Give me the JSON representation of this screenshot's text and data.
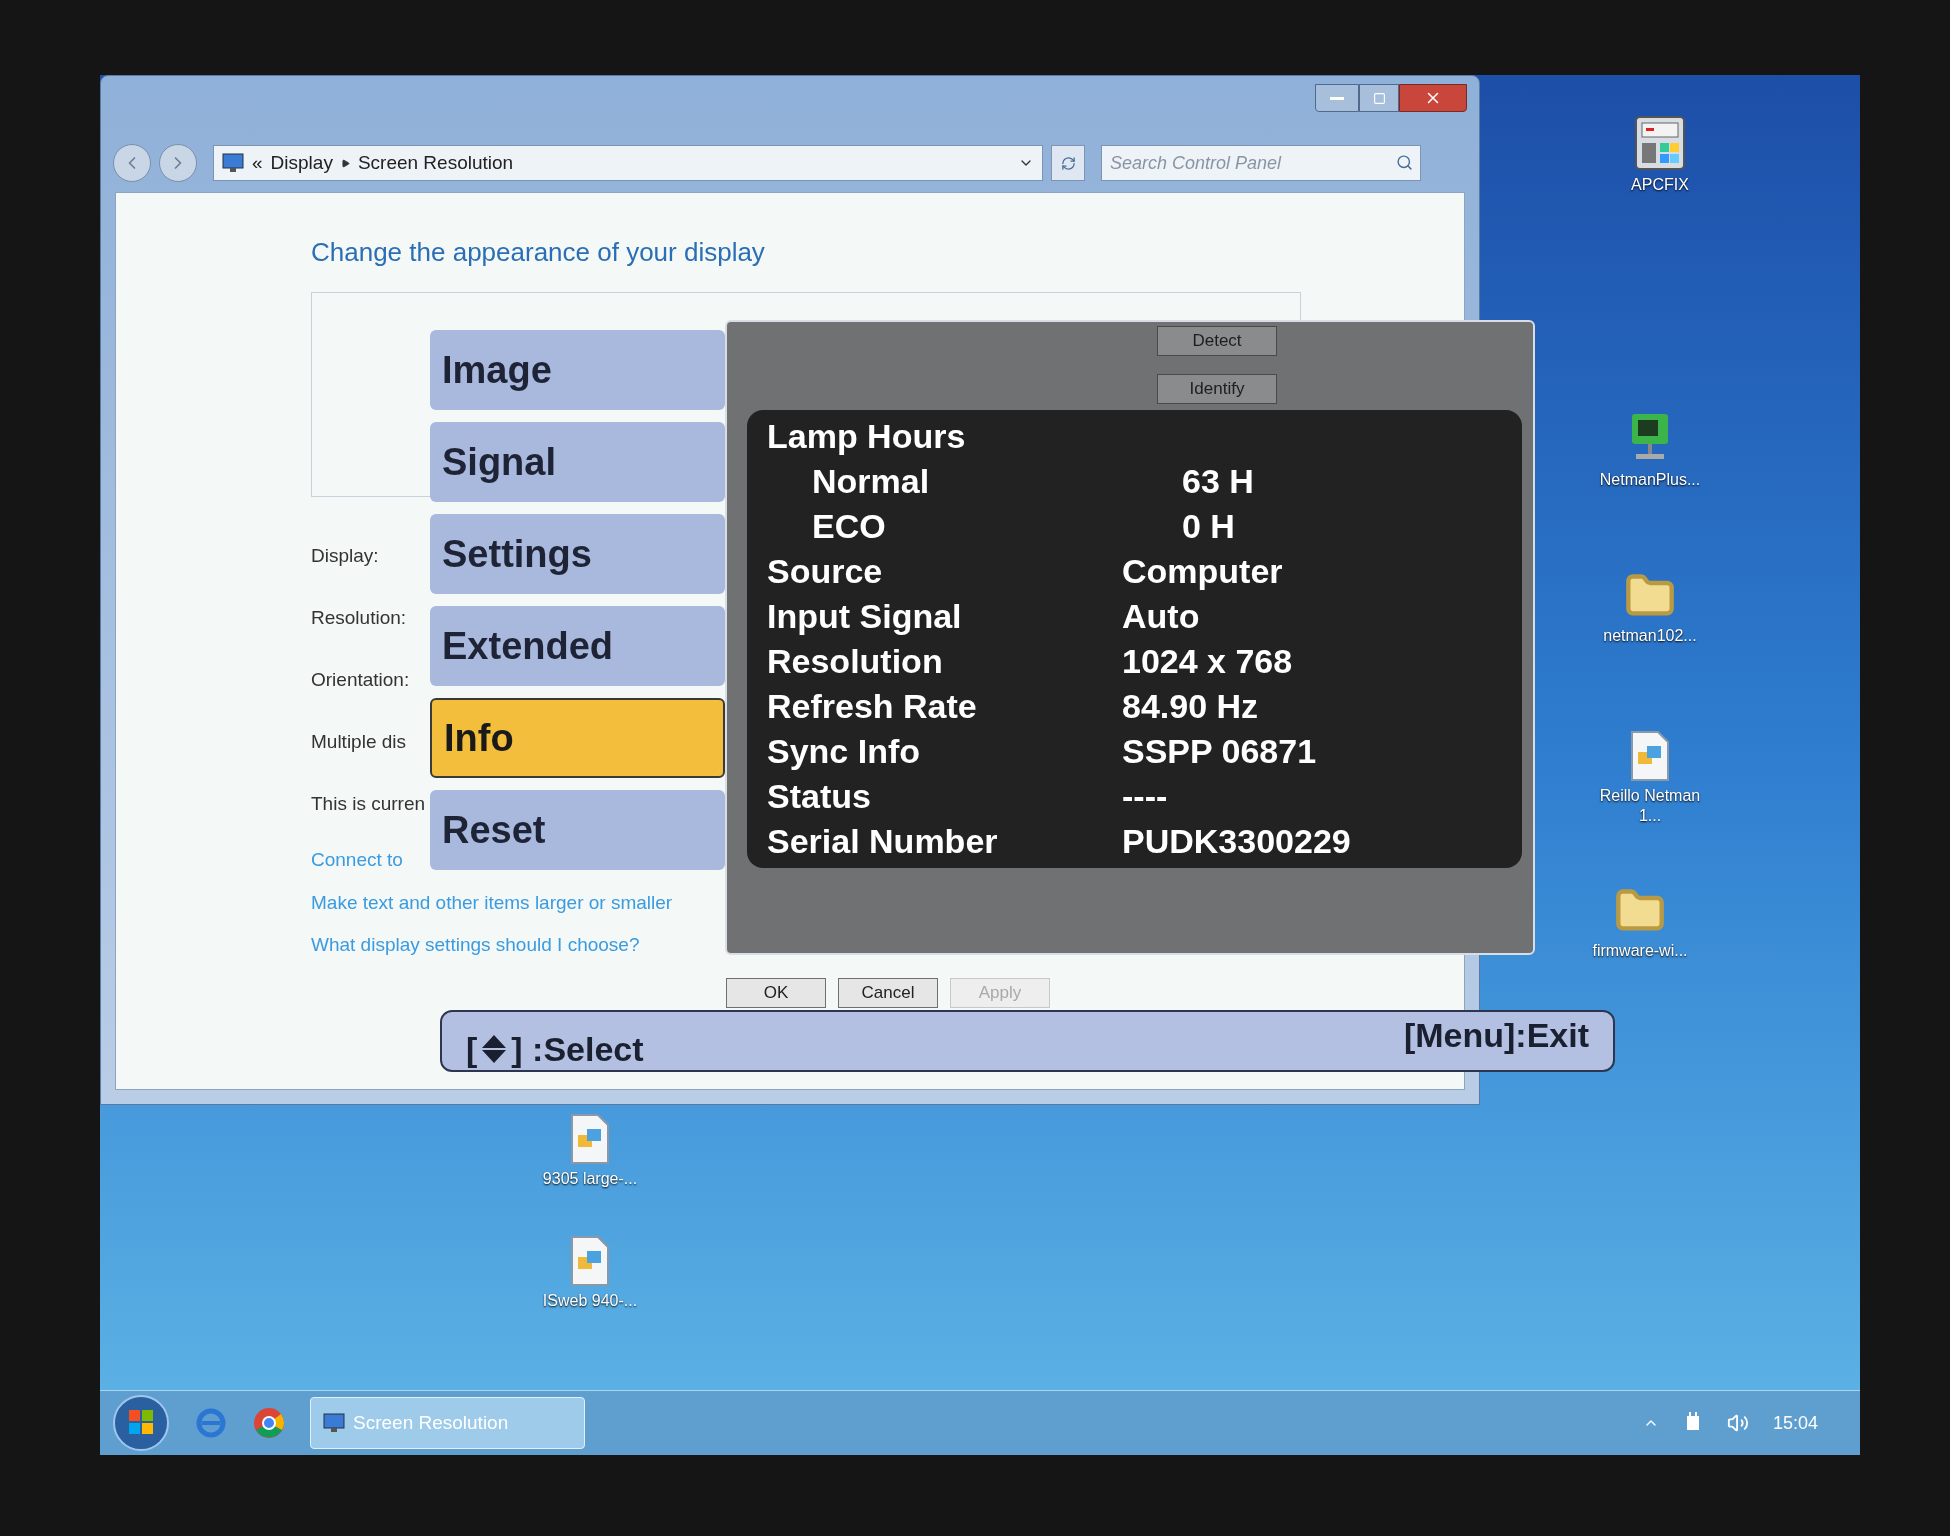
{
  "window": {
    "breadcrumb_prefix": "«",
    "breadcrumbs": [
      "Display",
      "Screen Resolution"
    ],
    "search": {
      "placeholder": "Search Control Panel"
    },
    "heading": "Change the appearance of your display",
    "detect_button": "Detect",
    "identify_button": "Identify",
    "fields": [
      "Display:",
      "Resolution:",
      "Orientation:",
      "Multiple dis",
      "This is curren"
    ],
    "links": [
      "Connect to",
      "Make text and other items larger or smaller",
      "What display settings should I choose?"
    ],
    "buttons": [
      {
        "label": "OK",
        "disabled": false
      },
      {
        "label": "Cancel",
        "disabled": false
      },
      {
        "label": "Apply",
        "disabled": true
      }
    ]
  },
  "osd": {
    "menu": [
      {
        "label": "Image",
        "selected": false
      },
      {
        "label": "Signal",
        "selected": false
      },
      {
        "label": "Settings",
        "selected": false
      },
      {
        "label": "Extended",
        "selected": false
      },
      {
        "label": "Info",
        "selected": true
      },
      {
        "label": "Reset",
        "selected": false
      }
    ],
    "info_rows": [
      {
        "label": "Lamp Hours",
        "children": [
          {
            "label": "Normal",
            "value": "63 H"
          },
          {
            "label": "ECO",
            "value": "0 H"
          }
        ]
      },
      {
        "label": "Source",
        "value": "Computer"
      },
      {
        "label": "Input Signal",
        "value": "Auto"
      },
      {
        "label": "Resolution",
        "value": "1024 x 768"
      },
      {
        "label": "Refresh Rate",
        "value": "84.90 Hz"
      },
      {
        "label": "Sync Info",
        "value": "SSPP 06871"
      },
      {
        "label": "Status",
        "value": "----"
      },
      {
        "label": "Serial Number",
        "value": "PUDK3300229"
      }
    ],
    "select_hint": {
      "open": "[",
      "close": "] :Select"
    },
    "exit_hint": "[Menu]:Exit"
  },
  "desktop_icons": [
    {
      "label": "APCFIX",
      "kind": "app"
    },
    {
      "label": "NetmanPlus...",
      "kind": "network"
    },
    {
      "label": "netman102...",
      "kind": "folder"
    },
    {
      "label": "Reillo Netman 1...",
      "kind": "document"
    },
    {
      "label": "firmware-wi...",
      "kind": "folder"
    },
    {
      "label": "9305 large-...",
      "kind": "document"
    },
    {
      "label": "ISweb 940-...",
      "kind": "document"
    }
  ],
  "taskbar": {
    "tasks": [
      {
        "label": "Screen Resolution",
        "selected": true
      }
    ],
    "clock": "15:04"
  }
}
